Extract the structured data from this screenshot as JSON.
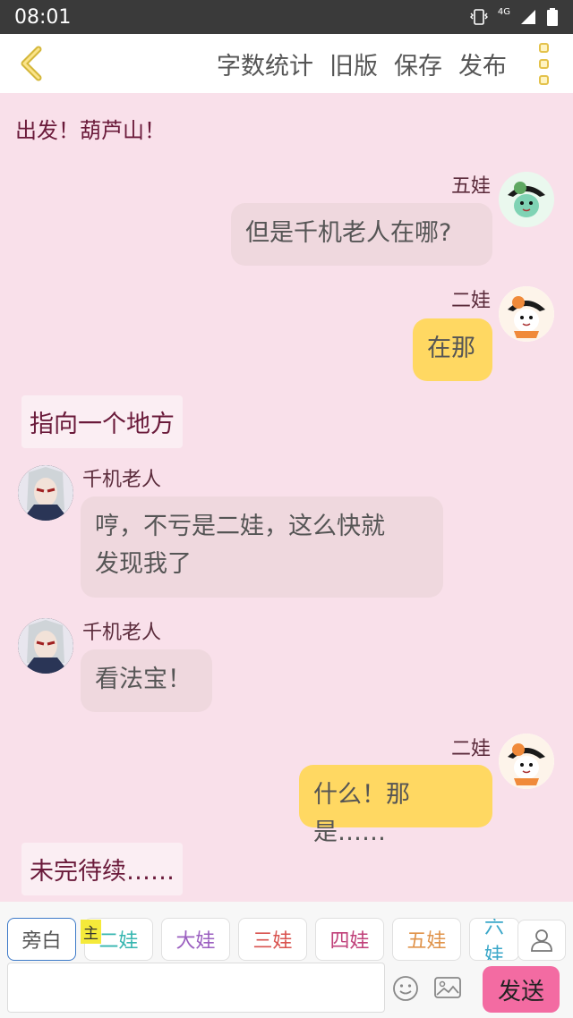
{
  "status": {
    "time": "08:01",
    "network": "4G"
  },
  "toolbar": {
    "actions": [
      "字数统计",
      "旧版",
      "保存",
      "发布"
    ]
  },
  "chat": {
    "intro": "出发！葫芦山！",
    "messages": [
      {
        "side": "right",
        "name": "五娃",
        "text": "但是千机老人在哪?",
        "style": "gray"
      },
      {
        "side": "right",
        "name": "二娃",
        "text": "在那",
        "style": "yellow"
      },
      {
        "narration": "指向一个地方"
      },
      {
        "side": "left",
        "name": "千机老人",
        "text_line1": "哼，不亏是二娃，这么快就",
        "text_line2": "发现我了",
        "style": "gray"
      },
      {
        "side": "left",
        "name": "千机老人",
        "text": "看法宝！",
        "style": "gray"
      },
      {
        "side": "right",
        "name": "二娃",
        "text": "什么！那是……",
        "style": "yellow"
      },
      {
        "narration": "未完待续……"
      }
    ]
  },
  "roles": [
    {
      "label": "旁白",
      "color": "#555555"
    },
    {
      "label": "二娃",
      "color": "#36b6b0"
    },
    {
      "label": "大娃",
      "color": "#9b5fc0"
    },
    {
      "label": "三娃",
      "color": "#d9534f"
    },
    {
      "label": "四娃",
      "color": "#c0417a"
    },
    {
      "label": "五娃",
      "color": "#e0934a"
    },
    {
      "label": "六娃",
      "color": "#3aa7c9"
    }
  ],
  "main_badge": "主",
  "input": {
    "value": "",
    "placeholder": ""
  },
  "send_label": "发送"
}
